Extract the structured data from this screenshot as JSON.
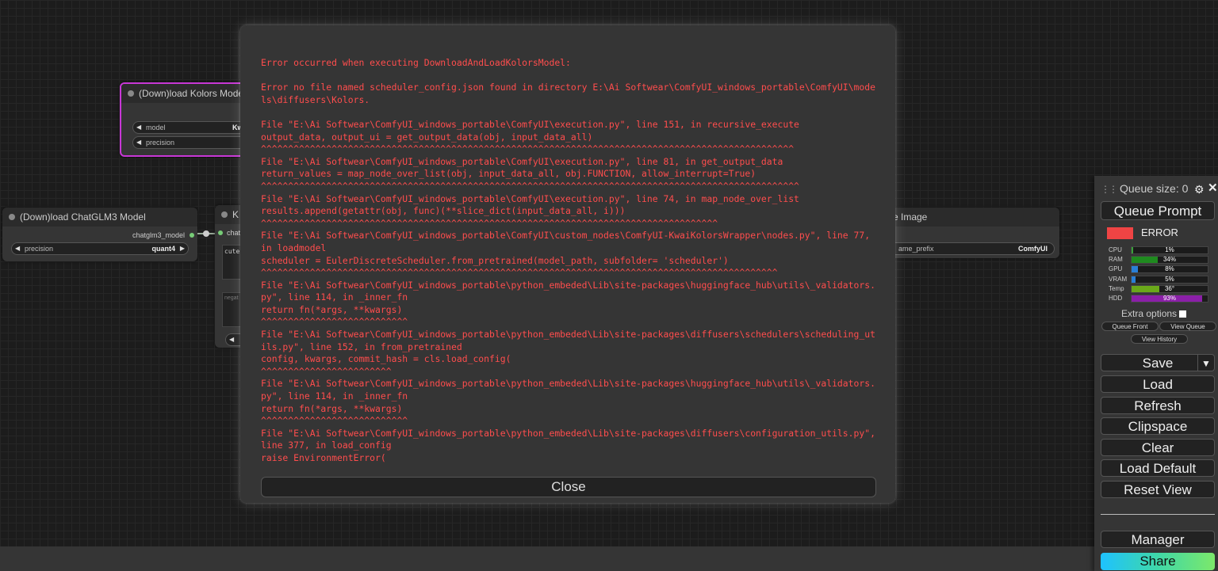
{
  "nodes": {
    "kolors": {
      "title": "(Down)load Kolors Model",
      "model_label": "model",
      "model_value": "Kwai",
      "precision_label": "precision"
    },
    "chatglm": {
      "title": "(Down)load ChatGLM3 Model",
      "output_label": "chatglm3_model",
      "precision_label": "precision",
      "precision_value": "quant4"
    },
    "middle": {
      "title": "K",
      "input_label": "chat",
      "text_value": "cute",
      "negative_placeholder": "negat"
    },
    "save": {
      "title": "e Image",
      "input_label": "s",
      "prefix_label": "ame_prefix",
      "prefix_value": "ComfyUI"
    }
  },
  "error_dialog": {
    "lines": [
      "Error occurred when executing DownloadAndLoadKolorsModel:",
      "",
      "Error no file named scheduler_config.json found in directory E:\\Ai Softwear\\ComfyUI_windows_portable\\ComfyUI\\models\\diffusers\\Kolors.",
      "",
      "File \"E:\\Ai Softwear\\ComfyUI_windows_portable\\ComfyUI\\execution.py\", line 151, in recursive_execute",
      "output_data, output_ui = get_output_data(obj, input_data_all)",
      "^^^^^^^^^^^^^^^^^^^^^^^^^^^^^^^^^^^^^^^^^^^^^^^^^^^^^^^^^^^^^^^^^^^^^^^^^^^^^^^^^^^^^^^^^^^^^^^^^^",
      "File \"E:\\Ai Softwear\\ComfyUI_windows_portable\\ComfyUI\\execution.py\", line 81, in get_output_data",
      "return_values = map_node_over_list(obj, input_data_all, obj.FUNCTION, allow_interrupt=True)",
      "^^^^^^^^^^^^^^^^^^^^^^^^^^^^^^^^^^^^^^^^^^^^^^^^^^^^^^^^^^^^^^^^^^^^^^^^^^^^^^^^^^^^^^^^^^^^^^^^^^^",
      "File \"E:\\Ai Softwear\\ComfyUI_windows_portable\\ComfyUI\\execution.py\", line 74, in map_node_over_list",
      "results.append(getattr(obj, func)(**slice_dict(input_data_all, i)))",
      "^^^^^^^^^^^^^^^^^^^^^^^^^^^^^^^^^^^^^^^^^^^^^^^^^^^^^^^^^^^^^^^^^^^^^^^^^^^^^^^^^^^^",
      "File \"E:\\Ai Softwear\\ComfyUI_windows_portable\\ComfyUI\\custom_nodes\\ComfyUI-KwaiKolorsWrapper\\nodes.py\", line 77, in loadmodel",
      "scheduler = EulerDiscreteScheduler.from_pretrained(model_path, subfolder= 'scheduler')",
      "^^^^^^^^^^^^^^^^^^^^^^^^^^^^^^^^^^^^^^^^^^^^^^^^^^^^^^^^^^^^^^^^^^^^^^^^^^^^^^^^^^^^^^^^^^^^^^^",
      "File \"E:\\Ai Softwear\\ComfyUI_windows_portable\\python_embeded\\Lib\\site-packages\\huggingface_hub\\utils\\_validators.py\", line 114, in _inner_fn",
      "return fn(*args, **kwargs)",
      "^^^^^^^^^^^^^^^^^^^^^^^^^^^",
      "File \"E:\\Ai Softwear\\ComfyUI_windows_portable\\python_embeded\\Lib\\site-packages\\diffusers\\schedulers\\scheduling_utils.py\", line 152, in from_pretrained",
      "config, kwargs, commit_hash = cls.load_config(",
      "^^^^^^^^^^^^^^^^^^^^^^^^",
      "File \"E:\\Ai Softwear\\ComfyUI_windows_portable\\python_embeded\\Lib\\site-packages\\huggingface_hub\\utils\\_validators.py\", line 114, in _inner_fn",
      "return fn(*args, **kwargs)",
      "^^^^^^^^^^^^^^^^^^^^^^^^^^^",
      "File \"E:\\Ai Softwear\\ComfyUI_windows_portable\\python_embeded\\Lib\\site-packages\\diffusers\\configuration_utils.py\", line 377, in load_config",
      "raise EnvironmentError("
    ],
    "close_label": "Close"
  },
  "menu": {
    "queue_size": "Queue size: 0",
    "queue_prompt": "Queue Prompt",
    "status_text": "ERROR",
    "status_color": "#ef4444",
    "stats": [
      {
        "label": "CPU",
        "value": "1%",
        "fraction": 0.01,
        "color": "#3aa13a"
      },
      {
        "label": "RAM",
        "value": "34%",
        "fraction": 0.34,
        "color": "#1f8a1f"
      },
      {
        "label": "GPU",
        "value": "8%",
        "fraction": 0.08,
        "color": "#2a7fd6"
      },
      {
        "label": "VRAM",
        "value": "5%",
        "fraction": 0.05,
        "color": "#2a7fd6"
      },
      {
        "label": "Temp",
        "value": "36°",
        "fraction": 0.36,
        "color": "#6aa81a"
      },
      {
        "label": "HDD",
        "value": "93%",
        "fraction": 0.93,
        "color": "#8b1fa8"
      }
    ],
    "extra_options": "Extra options",
    "queue_front": "Queue Front",
    "view_queue": "View Queue",
    "view_history": "View History",
    "save": "Save",
    "save_arrow": "▼",
    "load": "Load",
    "refresh": "Refresh",
    "clipspace": "Clipspace",
    "clear": "Clear",
    "load_default": "Load Default",
    "reset_view": "Reset View",
    "manager": "Manager",
    "share": "Share"
  }
}
